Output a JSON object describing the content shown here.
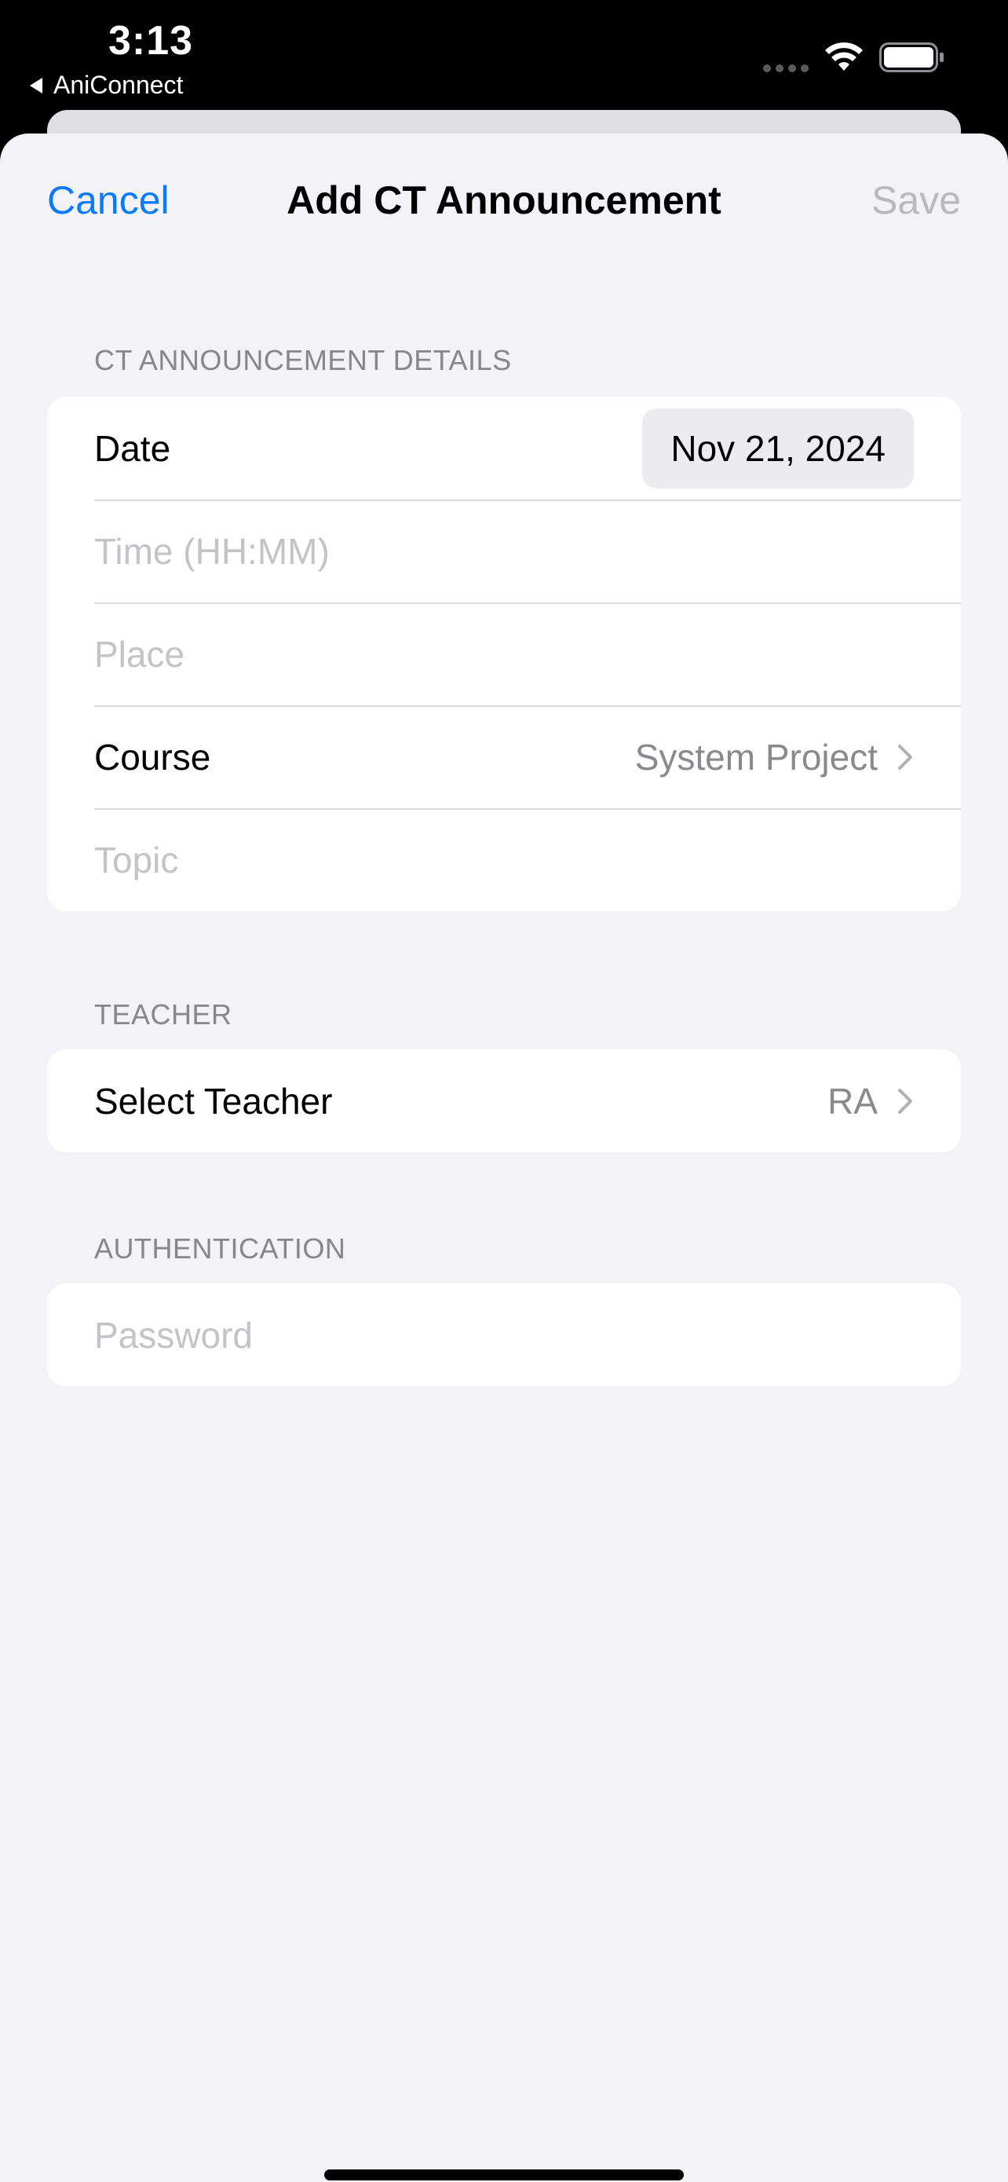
{
  "status_bar": {
    "time": "3:13",
    "back_app": "AniConnect"
  },
  "nav": {
    "cancel": "Cancel",
    "title": "Add CT Announcement",
    "save": "Save"
  },
  "details": {
    "header": "CT ANNOUNCEMENT DETAILS",
    "date_label": "Date",
    "date_value": "Nov 21, 2024",
    "time_placeholder": "Time (HH:MM)",
    "place_placeholder": "Place",
    "course_label": "Course",
    "course_value": "System Project",
    "topic_placeholder": "Topic"
  },
  "teacher": {
    "header": "TEACHER",
    "label": "Select Teacher",
    "value": "RA"
  },
  "authentication": {
    "header": "AUTHENTICATION",
    "password_placeholder": "Password"
  },
  "colors": {
    "accent": "#0a7aff",
    "disabled": "#b8b8bd",
    "background": "#f2f2f7"
  },
  "icons": {
    "back": "back-triangle-icon",
    "wifi": "wifi-icon",
    "battery": "battery-icon",
    "chevron": "chevron-right-icon"
  }
}
